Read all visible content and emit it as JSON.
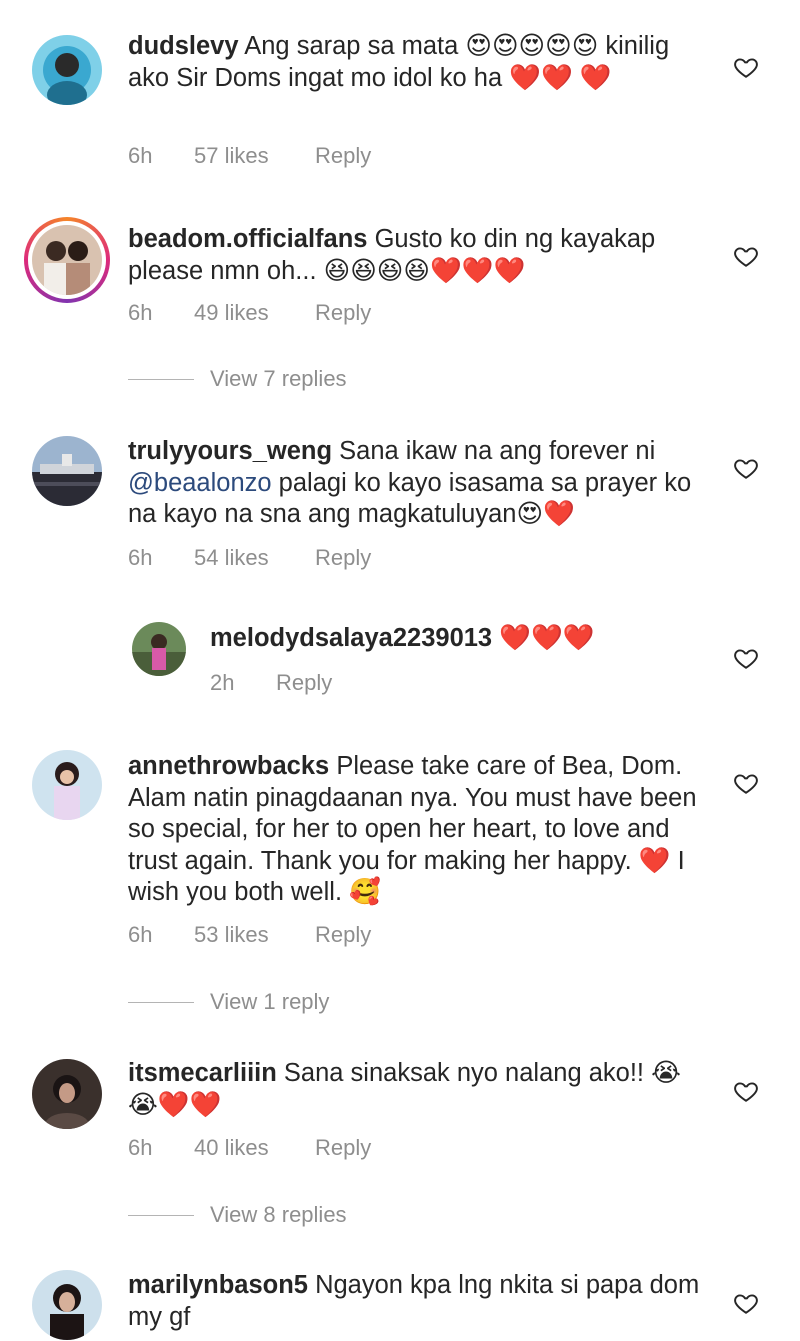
{
  "comments": [
    {
      "username": "dudslevy",
      "text": "Ang sarap sa mata 😍😍😍😍😍 kinilig ako Sir Doms ingat mo idol ko ha ❤️❤️ ❤️",
      "time": "6h",
      "likes": "57 likes",
      "reply": "Reply"
    },
    {
      "username": "beadom.officialfans",
      "text": "Gusto ko din ng kayakap please nmn oh... 😆😆😆😆❤️❤️❤️",
      "time": "6h",
      "likes": "49 likes",
      "reply": "Reply",
      "view_replies": "View 7 replies"
    },
    {
      "username": "trulyyours_weng",
      "text_before": "Sana ikaw na ang forever ni",
      "mention": "@beaalonzo",
      "text_after": "palagi ko kayo isasama sa prayer ko na kayo na sna ang magkatuluyan😍❤️",
      "time": "6h",
      "likes": "54 likes",
      "reply": "Reply"
    },
    {
      "username": "melodydsalaya2239013",
      "text": "❤️❤️❤️",
      "time": "2h",
      "reply": "Reply"
    },
    {
      "username": "annethrowbacks",
      "text": "Please take care of Bea, Dom. Alam natin pinagdaanan nya. You must have been so special, for her to open her heart, to love and trust again. Thank you for making her happy. ❤️ I wish you both well. 🥰",
      "time": "6h",
      "likes": "53 likes",
      "reply": "Reply",
      "view_replies": "View 1 reply"
    },
    {
      "username": "itsmecarliiin",
      "text": "Sana sinaksak nyo nalang ako!! 😭 😭❤️❤️",
      "time": "6h",
      "likes": "40 likes",
      "reply": "Reply",
      "view_replies": "View 8 replies"
    },
    {
      "username": "marilynbason5",
      "text": "Ngayon kpa lng nkita si papa dom my gf"
    }
  ],
  "icons": {
    "like": "heart-outline-icon"
  }
}
